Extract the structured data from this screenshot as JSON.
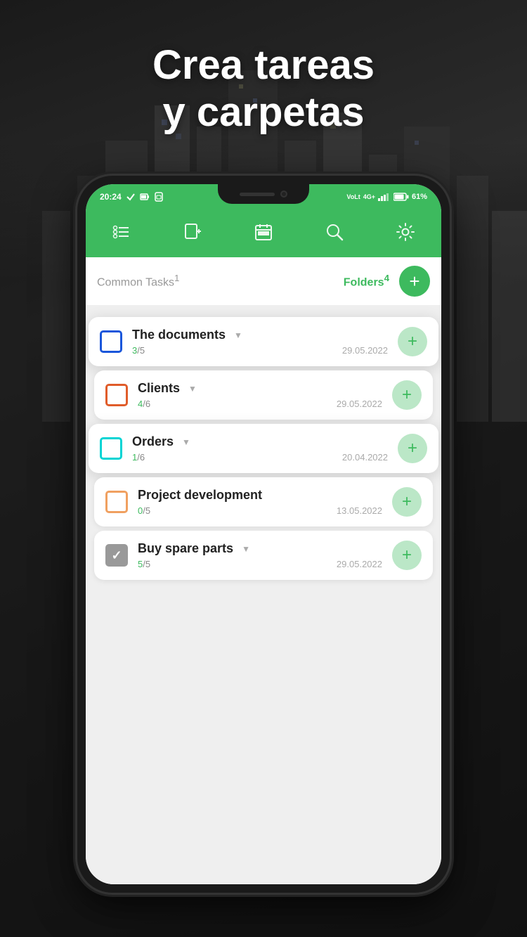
{
  "headline": {
    "line1": "Crea tareas",
    "line2": "y carpetas"
  },
  "status_bar": {
    "time": "20:24",
    "battery": "61%",
    "signal": "4G+"
  },
  "toolbar": {
    "icons": [
      "list-tasks-icon",
      "add-note-icon",
      "calendar-icon",
      "search-icon",
      "settings-icon"
    ]
  },
  "tabs": {
    "common_label": "Common Tasks",
    "common_superscript": "1",
    "folders_label": "Folders",
    "folders_superscript": "4",
    "add_label": "+"
  },
  "folders": [
    {
      "name": "The documents",
      "checkbox_color": "blue",
      "count_done": "3",
      "count_total": "5",
      "date": "29.05.2022",
      "elevated": true
    },
    {
      "name": "Clients",
      "checkbox_color": "orange",
      "count_done": "4",
      "count_total": "6",
      "date": "29.05.2022",
      "elevated": false
    },
    {
      "name": "Orders",
      "checkbox_color": "cyan",
      "count_done": "1",
      "count_total": "6",
      "date": "20.04.2022",
      "elevated": true
    },
    {
      "name": "Project development",
      "checkbox_color": "orange-light",
      "count_done": "0",
      "count_total": "5",
      "date": "13.05.2022",
      "elevated": false
    },
    {
      "name": "Buy spare parts",
      "checkbox_color": "checked",
      "count_done": "5",
      "count_total": "5",
      "date": "29.05.2022",
      "elevated": false
    }
  ]
}
